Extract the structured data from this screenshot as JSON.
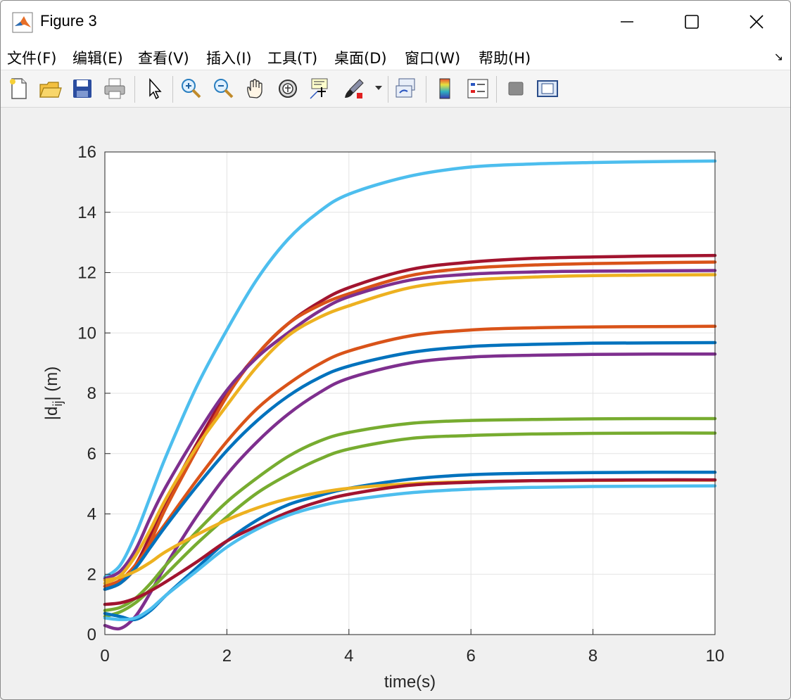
{
  "window": {
    "title": "Figure 3"
  },
  "menu": [
    "文件(F)",
    "编辑(E)",
    "查看(V)",
    "插入(I)",
    "工具(T)",
    "桌面(D)",
    "窗口(W)",
    "帮助(H)"
  ],
  "menu_arrow": "↘",
  "toolbar": [
    "new-file-icon",
    "open-folder-icon",
    "save-icon",
    "print-icon",
    "pointer-icon",
    "zoom-in-icon",
    "zoom-out-icon",
    "pan-hand-icon",
    "rotate-3d-icon",
    "data-cursor-icon",
    "brush-icon",
    "link-plot-icon",
    "colorbar-icon",
    "legend-icon",
    "hide-plot-tools-icon",
    "show-plot-tools-icon"
  ],
  "chart_data": {
    "type": "line",
    "title": "",
    "xlabel": "time(s)",
    "ylabel": "|d_ij| (m)",
    "xlim": [
      0,
      10
    ],
    "ylim": [
      0,
      16
    ],
    "xticks": [
      "0",
      "2",
      "4",
      "6",
      "8",
      "10"
    ],
    "yticks": [
      "0",
      "2",
      "4",
      "6",
      "8",
      "10",
      "12",
      "14",
      "16"
    ],
    "grid": true,
    "x": [
      0,
      0.25,
      0.5,
      0.75,
      1,
      1.5,
      2,
      2.5,
      3,
      3.5,
      4,
      5,
      6,
      7,
      8,
      9,
      10
    ],
    "series": [
      {
        "color": "#4DBEEE",
        "values": [
          1.9,
          2.3,
          3.3,
          4.6,
          5.9,
          8.2,
          10.1,
          11.8,
          13.1,
          14.0,
          14.6,
          15.2,
          15.5,
          15.6,
          15.65,
          15.68,
          15.7
        ]
      },
      {
        "color": "#A2142F",
        "values": [
          1.6,
          1.8,
          2.3,
          3.3,
          4.4,
          6.3,
          8.0,
          9.3,
          10.3,
          11.0,
          11.5,
          12.1,
          12.35,
          12.47,
          12.52,
          12.55,
          12.57
        ]
      },
      {
        "color": "#D95319",
        "values": [
          1.5,
          1.7,
          2.2,
          3.1,
          4.2,
          6.1,
          7.9,
          9.3,
          10.3,
          10.9,
          11.3,
          11.9,
          12.15,
          12.25,
          12.3,
          12.33,
          12.35
        ]
      },
      {
        "color": "#7E2F8E",
        "values": [
          1.85,
          2.1,
          2.8,
          3.9,
          4.9,
          6.6,
          8.1,
          9.2,
          10.0,
          10.7,
          11.2,
          11.75,
          11.95,
          12.02,
          12.05,
          12.06,
          12.07
        ]
      },
      {
        "color": "#EDB120",
        "values": [
          1.7,
          1.95,
          2.6,
          3.5,
          4.5,
          6.2,
          7.6,
          8.9,
          9.9,
          10.5,
          10.9,
          11.5,
          11.75,
          11.85,
          11.9,
          11.92,
          11.93
        ]
      },
      {
        "color": "#D95319",
        "values": [
          1.6,
          1.8,
          2.3,
          3.0,
          3.7,
          5.1,
          6.4,
          7.5,
          8.3,
          8.95,
          9.4,
          9.9,
          10.1,
          10.17,
          10.2,
          10.21,
          10.22
        ]
      },
      {
        "color": "#0072BD",
        "values": [
          1.5,
          1.7,
          2.2,
          2.9,
          3.6,
          4.9,
          6.1,
          7.1,
          7.9,
          8.5,
          8.9,
          9.35,
          9.55,
          9.62,
          9.66,
          9.67,
          9.68
        ]
      },
      {
        "color": "#7E2F8E",
        "values": [
          0.3,
          0.2,
          0.6,
          1.4,
          2.3,
          3.9,
          5.3,
          6.4,
          7.3,
          8.0,
          8.5,
          9.0,
          9.2,
          9.26,
          9.29,
          9.3,
          9.3
        ]
      },
      {
        "color": "#77AC30",
        "values": [
          0.8,
          0.9,
          1.2,
          1.7,
          2.3,
          3.4,
          4.4,
          5.2,
          5.9,
          6.4,
          6.7,
          7.0,
          7.1,
          7.13,
          7.15,
          7.16,
          7.16
        ]
      },
      {
        "color": "#77AC30",
        "values": [
          0.6,
          0.75,
          1.05,
          1.5,
          2.0,
          3.0,
          3.9,
          4.7,
          5.3,
          5.8,
          6.15,
          6.5,
          6.6,
          6.65,
          6.67,
          6.68,
          6.68
        ]
      },
      {
        "color": "#0072BD",
        "values": [
          0.7,
          0.6,
          0.5,
          0.8,
          1.3,
          2.2,
          3.1,
          3.8,
          4.3,
          4.6,
          4.85,
          5.15,
          5.3,
          5.35,
          5.37,
          5.38,
          5.38
        ]
      },
      {
        "color": "#EDB120",
        "values": [
          1.8,
          1.9,
          2.1,
          2.4,
          2.75,
          3.3,
          3.8,
          4.2,
          4.5,
          4.7,
          4.85,
          5.0,
          5.07,
          5.1,
          5.11,
          5.12,
          5.12
        ]
      },
      {
        "color": "#A2142F",
        "values": [
          1.0,
          1.05,
          1.2,
          1.45,
          1.75,
          2.4,
          3.1,
          3.6,
          4.05,
          4.4,
          4.65,
          4.95,
          5.05,
          5.1,
          5.12,
          5.13,
          5.13
        ]
      },
      {
        "color": "#4DBEEE",
        "values": [
          0.55,
          0.5,
          0.55,
          0.85,
          1.3,
          2.1,
          2.9,
          3.5,
          3.95,
          4.25,
          4.45,
          4.7,
          4.82,
          4.88,
          4.91,
          4.92,
          4.93
        ]
      }
    ]
  }
}
